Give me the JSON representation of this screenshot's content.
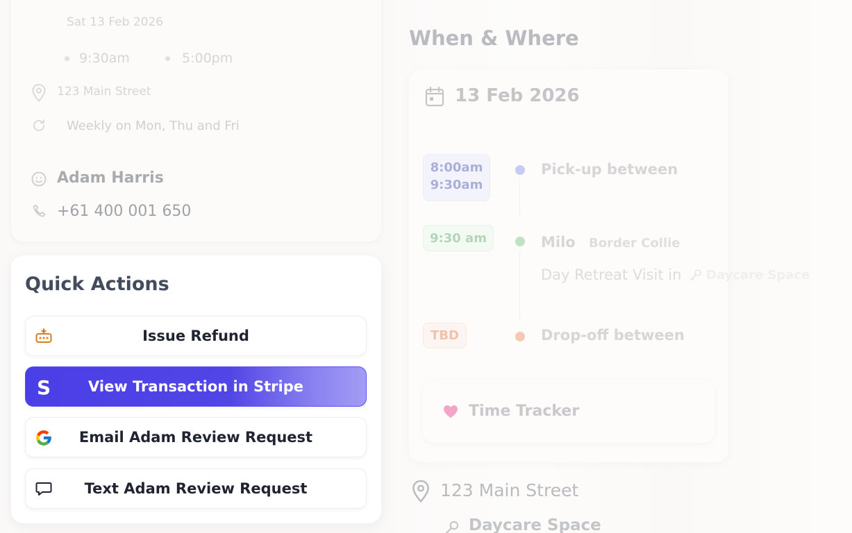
{
  "left": {
    "faded_date": "Sat 13 Feb 2026",
    "faded_time_start": "9:30am",
    "faded_time_end": "5:00pm",
    "faded_address": "123 Main Street",
    "faded_recurrence": "Weekly on Mon, Thu and Fri",
    "contact_name": "Adam Harris",
    "contact_phone": "+61 400 001 650"
  },
  "quick_actions": {
    "title": "Quick Actions",
    "buttons": [
      {
        "label": "Issue Refund",
        "icon": "refund-icon"
      },
      {
        "label": "View Transaction in Stripe",
        "icon": "stripe-icon"
      },
      {
        "label": "Email Adam Review Request",
        "icon": "google-icon"
      },
      {
        "label": "Text Adam Review Request",
        "icon": "chat-bubble-icon"
      }
    ]
  },
  "when_where": {
    "title": "When & Where",
    "date": "13 Feb 2026",
    "timeline": [
      {
        "time": "8:00am",
        "time2": "9:30am",
        "label": "Pick-up between",
        "color": "#c7cdf2"
      },
      {
        "time": "9:30 am",
        "label": "Milo",
        "breed": "Border Collie",
        "detail": "Day Retreat Visit in",
        "space": "Daycare Space",
        "color": "#bfe2c4"
      },
      {
        "time": "TBD",
        "label": "Drop-off between",
        "color": "#f6c9b3"
      }
    ],
    "tracker_label": "Time Tracker",
    "address": "123 Main Street",
    "space": "Daycare Space"
  },
  "colors": {
    "stripe_purple": "#4a3fe6",
    "refund_orange": "#e07a1f",
    "heart_pink": "#f3a5c9"
  }
}
